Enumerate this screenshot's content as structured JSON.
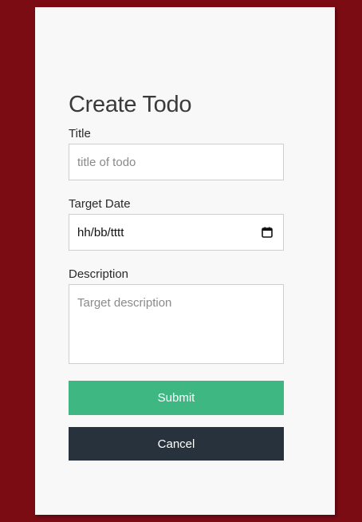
{
  "form": {
    "heading": "Create Todo",
    "title_label": "Title",
    "title_placeholder": "title of todo",
    "date_label": "Target Date",
    "date_value": "hh/bb/tttt",
    "date_icon": "calendar-icon",
    "description_label": "Description",
    "description_placeholder": "Target description",
    "submit_label": "Submit",
    "cancel_label": "Cancel"
  },
  "colors": {
    "background": "#7b0c14",
    "card": "#f8f8f8",
    "submit": "#3eb782",
    "cancel": "#28323c"
  }
}
